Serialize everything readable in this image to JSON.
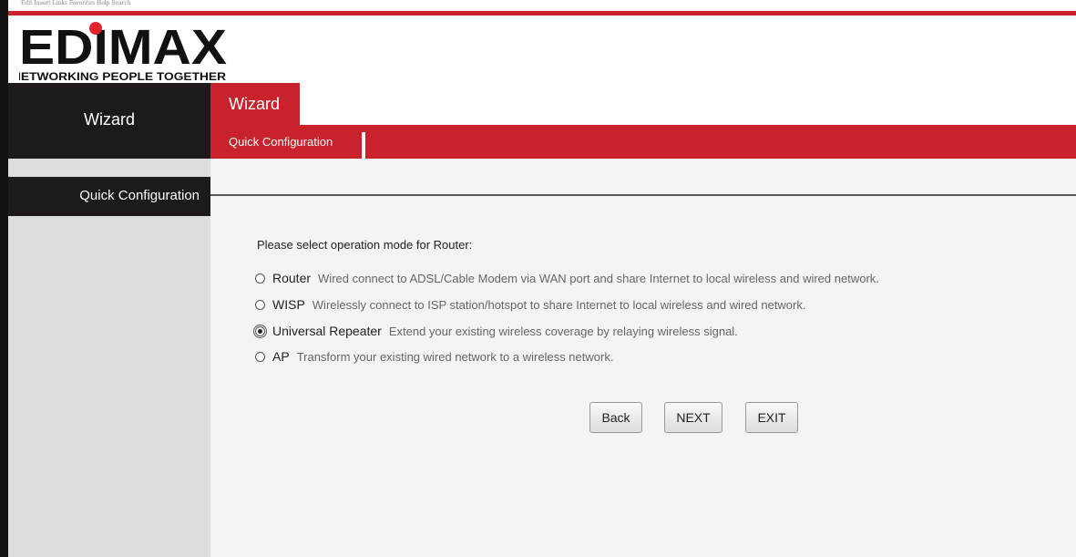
{
  "browser_strip": {
    "text": "Edit  Insert  Links  Favorites  Help  Search"
  },
  "brand": {
    "logo_text": "EDIMAX",
    "tagline": "NETWORKING PEOPLE TOGETHER",
    "accent_color": "#c8232c"
  },
  "nav": {
    "left_label": "Wizard",
    "active_tab": "Wizard",
    "sub_item": "Quick Configuration"
  },
  "sidebar": {
    "section_label": "Quick Configuration"
  },
  "main": {
    "prompt": "Please select operation mode for Router:",
    "options": [
      {
        "name": "Router",
        "description": "Wired connect to ADSL/Cable Modem via WAN port and share Internet to local wireless and wired network.",
        "selected": false
      },
      {
        "name": "WISP",
        "description": "Wirelessly connect to ISP station/hotspot to share Internet to local wireless and wired network.",
        "selected": false
      },
      {
        "name": "Universal Repeater",
        "description": "Extend your existing wireless coverage by relaying wireless signal.",
        "selected": true
      },
      {
        "name": "AP",
        "description": "Transform your existing wired network to a wireless network.",
        "selected": false
      }
    ],
    "buttons": {
      "back": "Back",
      "next": "NEXT",
      "exit": "EXIT"
    }
  }
}
